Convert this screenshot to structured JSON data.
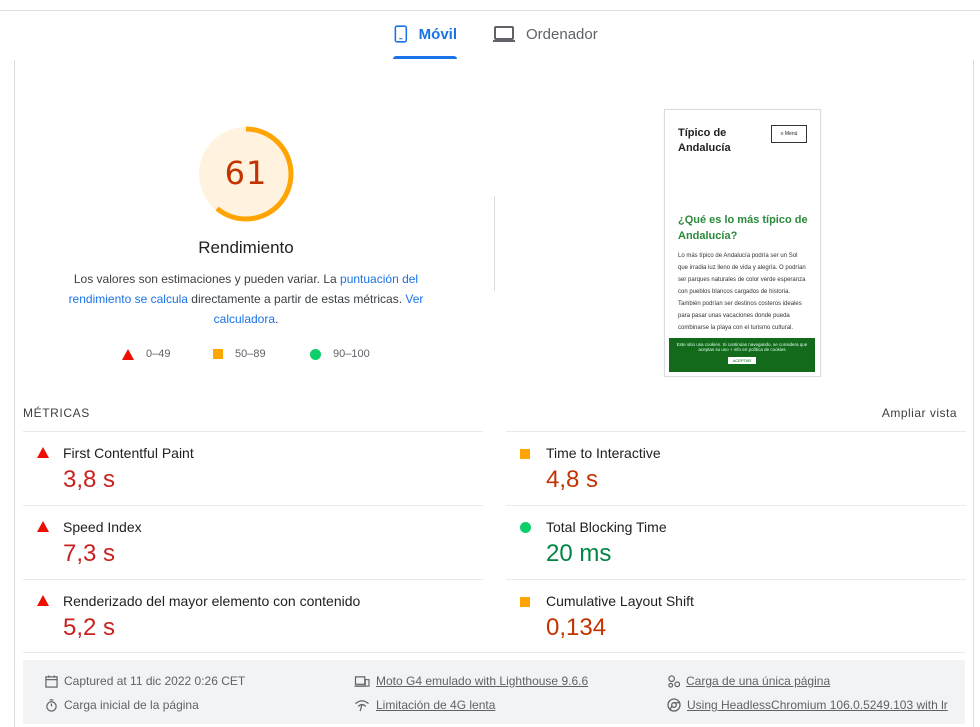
{
  "tabs": [
    {
      "label": "Móvil",
      "icon": "smartphone-icon",
      "active": true
    },
    {
      "label": "Ordenador",
      "icon": "laptop-icon",
      "active": false
    }
  ],
  "summary": {
    "score": "61",
    "score_fraction": 0.61,
    "title": "Rendimiento",
    "desc_text1": "Los valores son estimaciones y pueden variar. La ",
    "desc_link1": "puntuación del rendimiento se calcula",
    "desc_text2": " directamente a partir de estas métricas. ",
    "desc_link2": "Ver calculadora",
    "desc_text3": ".",
    "legend": [
      {
        "label": "0–49",
        "icon": "triangle-fail-icon",
        "color": "#eb0f00"
      },
      {
        "label": "50–89",
        "icon": "square-average-icon",
        "color": "#ffa400"
      },
      {
        "label": "90–100",
        "icon": "circle-pass-icon",
        "color": "#0cce6b"
      }
    ]
  },
  "screenshot": {
    "brand": "Típico de Andalucía",
    "menu": "Menú",
    "heading": "¿Qué es lo más típico de Andalucía?",
    "body": "Lo más típico de Andalucía podría ser un Sol que irradia luz lleno de vida y alegría. O podrían ser parques naturales de color verde esperanza con pueblos blancos cargados de historia. También podrían ser destinos costeros ideales para pasar unas vacaciones donde pueda combinarse la playa con el turismo cultural.",
    "cookie_text": "Este sitio usa cookies. Si continúas navegando, se considera que aceptas su uso + info en política de cookies",
    "cookie_button": "ACEPTAR"
  },
  "metrics": {
    "title": "MÉTRICAS",
    "expand": "Ampliar vista",
    "left": [
      {
        "name": "First Contentful Paint",
        "value": "3,8 s",
        "status": "fail"
      },
      {
        "name": "Speed Index",
        "value": "7,3 s",
        "status": "fail"
      },
      {
        "name": "Renderizado del mayor elemento con contenido",
        "value": "5,2 s",
        "status": "fail"
      }
    ],
    "right": [
      {
        "name": "Time to Interactive",
        "value": "4,8 s",
        "status": "average"
      },
      {
        "name": "Total Blocking Time",
        "value": "20 ms",
        "status": "pass"
      },
      {
        "name": "Cumulative Layout Shift",
        "value": "0,134",
        "status": "average"
      }
    ]
  },
  "footer": {
    "captured": "Captured at 11 dic 2022 0:26 CET",
    "device": "Moto G4 emulado with Lighthouse 9.6.6",
    "session": "Carga de una única página",
    "initial": "Carga inicial de la página",
    "throttle": "Limitación de 4G lenta",
    "browser": "Using HeadlessChromium 106.0.5249.103 with lr"
  },
  "colors": {
    "accent": "#1a73e8",
    "fail": "#eb0f00",
    "average": "#ffa400",
    "pass": "#0cce6b"
  }
}
